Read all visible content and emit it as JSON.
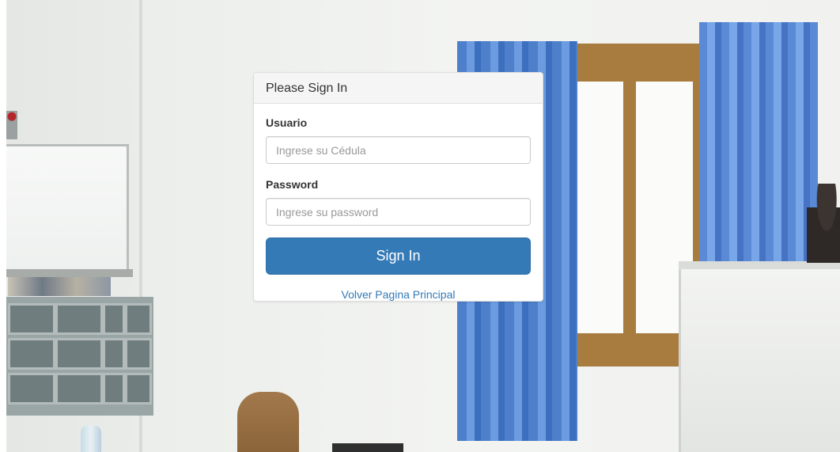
{
  "login": {
    "title": "Please Sign In",
    "username": {
      "label": "Usuario",
      "placeholder": "Ingrese su Cédula",
      "value": ""
    },
    "password": {
      "label": "Password",
      "placeholder": "Ingrese su password",
      "value": ""
    },
    "submit_label": "Sign In",
    "back_link_label": "Volver Pagina Principal"
  },
  "colors": {
    "primary": "#337ab7",
    "panel_heading_bg": "#f5f5f5",
    "curtain": "#5a8ad6"
  }
}
